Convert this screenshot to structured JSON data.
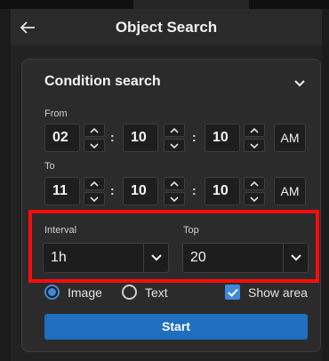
{
  "window": {
    "title": "Object Search"
  },
  "condition": {
    "title": "Condition search"
  },
  "from": {
    "label": "From",
    "hour": "02",
    "minute": "10",
    "second": "10",
    "ampm": "AM"
  },
  "to": {
    "label": "To",
    "hour": "11",
    "minute": "10",
    "second": "10",
    "ampm": "AM"
  },
  "time_separator": ":",
  "interval": {
    "label": "Interval",
    "value": "1h"
  },
  "top": {
    "label": "Top",
    "value": "20"
  },
  "options": {
    "image_label": "Image",
    "text_label": "Text",
    "show_area_label": "Show area",
    "selected": "Image",
    "show_area_checked": true
  },
  "actions": {
    "start_label": "Start"
  },
  "colors": {
    "background": "#1b1b1b",
    "card": "#2b2b2b",
    "accent": "#1f6fc0",
    "highlight": "#ff0c0c"
  },
  "icons": {
    "back": "arrow-left-icon",
    "collapse": "chevron-down-icon",
    "increment": "chevron-up-icon",
    "decrement": "chevron-down-icon",
    "check": "checkmark-icon"
  }
}
